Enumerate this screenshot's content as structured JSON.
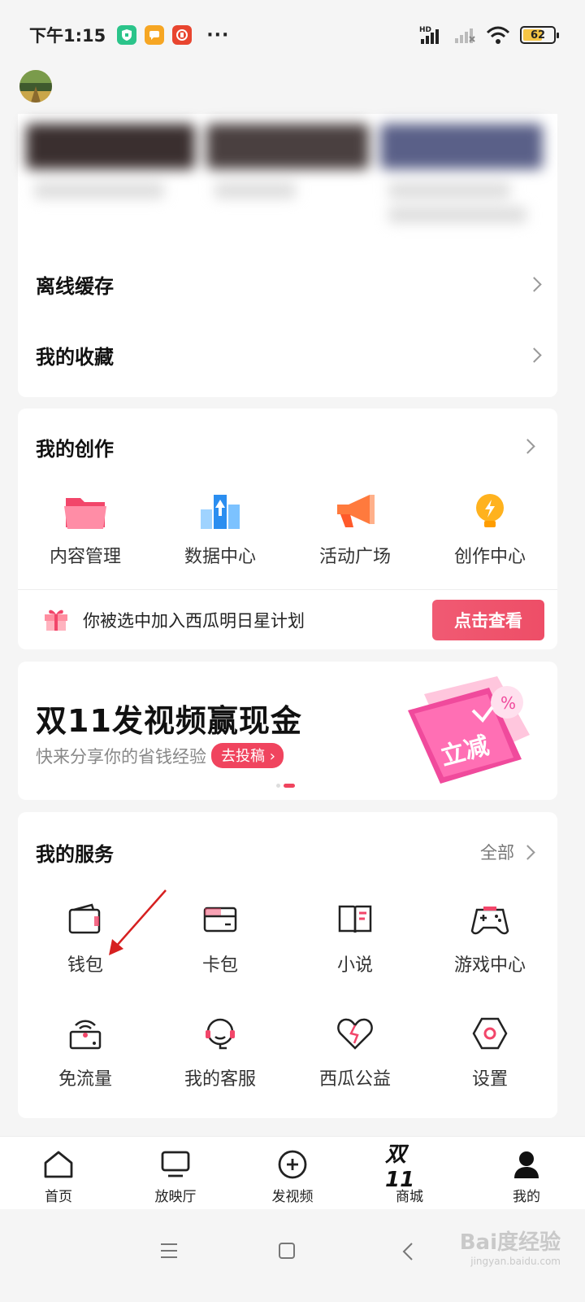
{
  "status_bar": {
    "time": "下午1:15",
    "dots": "···",
    "battery": "62"
  },
  "menu": {
    "offline_cache": "离线缓存",
    "favorites": "我的收藏"
  },
  "creation": {
    "title": "我的创作",
    "items": [
      {
        "label": "内容管理",
        "icon": "folder-icon"
      },
      {
        "label": "数据中心",
        "icon": "chart-icon"
      },
      {
        "label": "活动广场",
        "icon": "megaphone-icon"
      },
      {
        "label": "创作中心",
        "icon": "bulb-icon"
      }
    ],
    "star_text": "你被选中加入西瓜明日星计划",
    "star_button": "点击查看"
  },
  "banner": {
    "title": "双11发视频赢现金",
    "subtitle": "快来分享你的省钱经验",
    "cta": "去投稿",
    "art_text": "立减",
    "dot_count": 2,
    "active_dot": 1
  },
  "services": {
    "title": "我的服务",
    "all_label": "全部",
    "items": [
      {
        "label": "钱包",
        "icon": "wallet-icon"
      },
      {
        "label": "卡包",
        "icon": "card-icon"
      },
      {
        "label": "小说",
        "icon": "book-icon"
      },
      {
        "label": "游戏中心",
        "icon": "gamepad-icon"
      },
      {
        "label": "免流量",
        "icon": "wifi-box-icon"
      },
      {
        "label": "我的客服",
        "icon": "headset-icon"
      },
      {
        "label": "西瓜公益",
        "icon": "heart-icon"
      },
      {
        "label": "设置",
        "icon": "hexagon-settings-icon"
      }
    ]
  },
  "tab_bar": {
    "items": [
      {
        "label": "首页",
        "icon": "home-icon"
      },
      {
        "label": "放映厅",
        "icon": "tv-icon"
      },
      {
        "label": "发视频",
        "icon": "plus-circle-icon"
      },
      {
        "label": "商城",
        "icon": "double11-icon",
        "icon_text": "双11"
      },
      {
        "label": "我的",
        "icon": "person-icon",
        "active": true
      }
    ]
  },
  "watermark": {
    "text": "Bai度经验",
    "sub": "jingyan.baidu.com"
  },
  "colors": {
    "accent": "#f0445e",
    "background": "#f5f5f5"
  }
}
